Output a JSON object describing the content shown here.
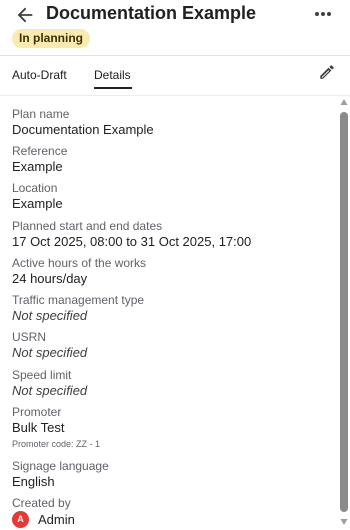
{
  "header": {
    "title": "Documentation Example",
    "status_badge": "In planning",
    "back_icon": "arrow-back-icon",
    "more_icon": "more-horizontal-icon"
  },
  "tabs": [
    {
      "label": "Auto-Draft",
      "active": false
    },
    {
      "label": "Details",
      "active": true
    }
  ],
  "edit_icon": "pencil-icon",
  "fields": {
    "plan_name": {
      "label": "Plan name",
      "value": "Documentation Example"
    },
    "reference": {
      "label": "Reference",
      "value": "Example"
    },
    "location": {
      "label": "Location",
      "value": "Example"
    },
    "dates": {
      "label": "Planned start and end dates",
      "value": "17 Oct 2025, 08:00 to 31 Oct 2025, 17:00"
    },
    "active_hours": {
      "label": "Active hours of the works",
      "value": "24 hours/day"
    },
    "traffic_mgmt": {
      "label": "Traffic management type",
      "value": "Not specified"
    },
    "usrn": {
      "label": "USRN",
      "value": "Not specified"
    },
    "speed_limit": {
      "label": "Speed limit",
      "value": "Not specified"
    },
    "promoter": {
      "label": "Promoter",
      "value": "Bulk Test",
      "subtext": "Promoter code: ZZ - 1"
    },
    "signage_language": {
      "label": "Signage language",
      "value": "English"
    },
    "created_by": {
      "label": "Created by",
      "avatar_initial": "A",
      "value": "Admin"
    }
  },
  "colors": {
    "badge_bg": "#fbeab0",
    "avatar_bg": "#e53935",
    "scrollbar": "#8a8a8a"
  }
}
